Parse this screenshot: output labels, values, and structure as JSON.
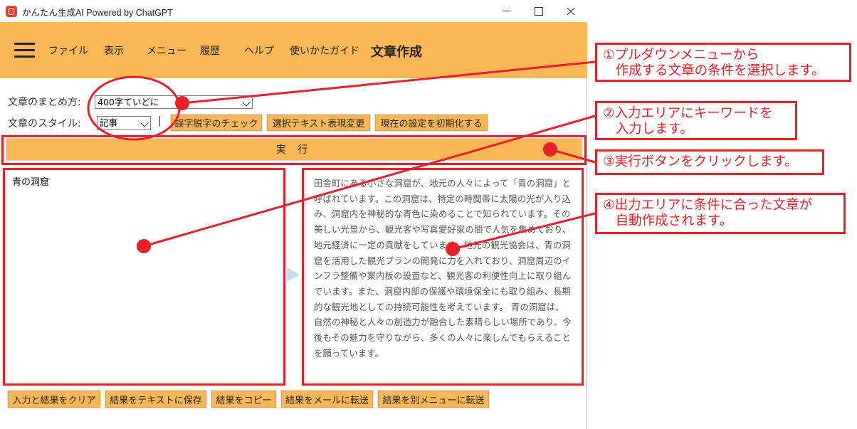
{
  "window": {
    "title": "かんたん生成AI Powered by ChatGPT"
  },
  "menubar": {
    "items": [
      "ファイル",
      "表示",
      "メニュー",
      "履歴",
      "ヘルプ",
      "使いかたガイド"
    ],
    "page_title": "文章作成"
  },
  "settings": {
    "summary_label": "文章のまとめ方:",
    "summary_value": "400字ていどに",
    "style_label": "文章のスタイル:",
    "style_value": "記事",
    "separator": "|"
  },
  "toolbar": {
    "typo_check": "誤字脱字のチェック",
    "rephrase": "選択テキスト表現変更",
    "reset": "現在の設定を初期化する"
  },
  "run_button": "実 行",
  "input": {
    "text": "青の洞窟"
  },
  "output": {
    "text": "田舎町にある小さな洞窟が、地元の人々によって「青の洞窟」と呼ばれています。この洞窟は、特定の時間帯に太陽の光が入り込み、洞窟内を神秘的な青色に染めることで知られています。その美しい光景から、観光客や写真愛好家の間で人気を集めており、地元経済に一定の貢献をしています。地元の観光協会は、青の洞窟を活用した観光プランの開発に力を入れており、洞窟周辺のインフラ整備や案内板の設置など、観光客の利便性向上に取り組んでいます。また、洞窟内部の保護や環境保全にも取り組み、長期的な観光地としての持続可能性を考えています。 青の洞窟は、自然の神秘と人々の創造力が融合した素晴らしい場所であり、今後もその魅力を守りながら、多くの人々に楽しんでもらえることを願っています。"
  },
  "bottom_buttons": [
    "入力と結果をクリア",
    "結果をテキストに保存",
    "結果をコピー",
    "結果をメールに転送",
    "結果を別メニューに転送"
  ],
  "annotations": {
    "note1": "①プルダウンメニューから\n   作成する文章の条件を選択します。",
    "note2": "②入力エリアにキーワードを\n   入力します。",
    "note3": "③実行ボタンをクリックします。",
    "note4": "④出力エリアに条件に合った文章が\n   自動作成されます。"
  },
  "colors": {
    "accent": "#f9b756",
    "annotation": "#e8202a"
  }
}
